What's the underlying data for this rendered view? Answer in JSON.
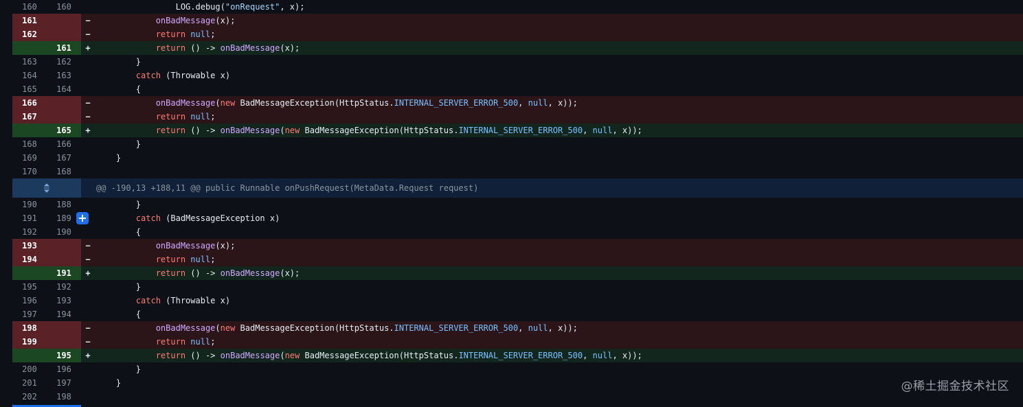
{
  "hunk_header": "@@ -190,13 +188,11 @@ public Runnable onPushRequest(MetaData.Request request)",
  "expand_icon": "expand-icon",
  "add_comment_icon": "plus-icon",
  "watermark": "@稀土掘金技术社区",
  "lines": [
    {
      "type": "ctx",
      "old": "160",
      "new": "160",
      "marker": "",
      "tokens": [
        {
          "c": "tx",
          "t": "                LOG.debug("
        },
        {
          "c": "str",
          "t": "\"onRequest\""
        },
        {
          "c": "tx",
          "t": ", x);"
        }
      ]
    },
    {
      "type": "del",
      "old": "161",
      "new": "",
      "marker": "−",
      "tokens": [
        {
          "c": "tx",
          "t": "            "
        },
        {
          "c": "fn",
          "t": "onBadMessage"
        },
        {
          "c": "tx",
          "t": "(x);"
        }
      ]
    },
    {
      "type": "del",
      "old": "162",
      "new": "",
      "marker": "−",
      "tokens": [
        {
          "c": "tx",
          "t": "            "
        },
        {
          "c": "kw",
          "t": "return"
        },
        {
          "c": "tx",
          "t": " "
        },
        {
          "c": "cn",
          "t": "null"
        },
        {
          "c": "tx",
          "t": ";"
        }
      ]
    },
    {
      "type": "add",
      "old": "",
      "new": "161",
      "marker": "+",
      "tokens": [
        {
          "c": "tx",
          "t": "            "
        },
        {
          "c": "kw",
          "t": "return"
        },
        {
          "c": "tx",
          "t": " () -> "
        },
        {
          "c": "fn",
          "t": "onBadMessage"
        },
        {
          "c": "tx",
          "t": "(x);"
        }
      ]
    },
    {
      "type": "ctx",
      "old": "163",
      "new": "162",
      "marker": "",
      "tokens": [
        {
          "c": "tx",
          "t": "        }"
        }
      ]
    },
    {
      "type": "ctx",
      "old": "164",
      "new": "163",
      "marker": "",
      "tokens": [
        {
          "c": "tx",
          "t": "        "
        },
        {
          "c": "kw",
          "t": "catch"
        },
        {
          "c": "tx",
          "t": " (Throwable x)"
        }
      ]
    },
    {
      "type": "ctx",
      "old": "165",
      "new": "164",
      "marker": "",
      "tokens": [
        {
          "c": "tx",
          "t": "        {"
        }
      ]
    },
    {
      "type": "del",
      "old": "166",
      "new": "",
      "marker": "−",
      "tokens": [
        {
          "c": "tx",
          "t": "            "
        },
        {
          "c": "fn",
          "t": "onBadMessage"
        },
        {
          "c": "tx",
          "t": "("
        },
        {
          "c": "kw",
          "t": "new"
        },
        {
          "c": "tx",
          "t": " BadMessageException(HttpStatus."
        },
        {
          "c": "cn",
          "t": "INTERNAL_SERVER_ERROR_500"
        },
        {
          "c": "tx",
          "t": ", "
        },
        {
          "c": "cn",
          "t": "null"
        },
        {
          "c": "tx",
          "t": ", x));"
        }
      ]
    },
    {
      "type": "del",
      "old": "167",
      "new": "",
      "marker": "−",
      "tokens": [
        {
          "c": "tx",
          "t": "            "
        },
        {
          "c": "kw",
          "t": "return"
        },
        {
          "c": "tx",
          "t": " "
        },
        {
          "c": "cn",
          "t": "null"
        },
        {
          "c": "tx",
          "t": ";"
        }
      ]
    },
    {
      "type": "add",
      "old": "",
      "new": "165",
      "marker": "+",
      "tokens": [
        {
          "c": "tx",
          "t": "            "
        },
        {
          "c": "kw",
          "t": "return"
        },
        {
          "c": "tx",
          "t": " () -> "
        },
        {
          "c": "fn",
          "t": "onBadMessage"
        },
        {
          "c": "tx",
          "t": "("
        },
        {
          "c": "kw",
          "t": "new"
        },
        {
          "c": "tx",
          "t": " BadMessageException(HttpStatus."
        },
        {
          "c": "cn",
          "t": "INTERNAL_SERVER_ERROR_500"
        },
        {
          "c": "tx",
          "t": ", "
        },
        {
          "c": "cn",
          "t": "null"
        },
        {
          "c": "tx",
          "t": ", x));"
        }
      ]
    },
    {
      "type": "ctx",
      "old": "168",
      "new": "166",
      "marker": "",
      "tokens": [
        {
          "c": "tx",
          "t": "        }"
        }
      ]
    },
    {
      "type": "ctx",
      "old": "169",
      "new": "167",
      "marker": "",
      "tokens": [
        {
          "c": "tx",
          "t": "    }"
        }
      ]
    },
    {
      "type": "ctx",
      "old": "170",
      "new": "168",
      "marker": "",
      "tokens": []
    },
    {
      "type": "hunk"
    },
    {
      "type": "ctx",
      "old": "190",
      "new": "188",
      "marker": "",
      "tokens": [
        {
          "c": "tx",
          "t": "        }"
        }
      ]
    },
    {
      "type": "ctx",
      "old": "191",
      "new": "189",
      "marker": "",
      "plus": true,
      "tokens": [
        {
          "c": "tx",
          "t": "        "
        },
        {
          "c": "kw",
          "t": "catch"
        },
        {
          "c": "tx",
          "t": " (BadMessageException x)"
        }
      ]
    },
    {
      "type": "ctx",
      "old": "192",
      "new": "190",
      "marker": "",
      "tokens": [
        {
          "c": "tx",
          "t": "        {"
        }
      ]
    },
    {
      "type": "del",
      "old": "193",
      "new": "",
      "marker": "−",
      "tokens": [
        {
          "c": "tx",
          "t": "            "
        },
        {
          "c": "fn",
          "t": "onBadMessage"
        },
        {
          "c": "tx",
          "t": "(x);"
        }
      ]
    },
    {
      "type": "del",
      "old": "194",
      "new": "",
      "marker": "−",
      "tokens": [
        {
          "c": "tx",
          "t": "            "
        },
        {
          "c": "kw",
          "t": "return"
        },
        {
          "c": "tx",
          "t": " "
        },
        {
          "c": "cn",
          "t": "null"
        },
        {
          "c": "tx",
          "t": ";"
        }
      ]
    },
    {
      "type": "add",
      "old": "",
      "new": "191",
      "marker": "+",
      "tokens": [
        {
          "c": "tx",
          "t": "            "
        },
        {
          "c": "kw",
          "t": "return"
        },
        {
          "c": "tx",
          "t": " () -> "
        },
        {
          "c": "fn",
          "t": "onBadMessage"
        },
        {
          "c": "tx",
          "t": "(x);"
        }
      ]
    },
    {
      "type": "ctx",
      "old": "195",
      "new": "192",
      "marker": "",
      "tokens": [
        {
          "c": "tx",
          "t": "        }"
        }
      ]
    },
    {
      "type": "ctx",
      "old": "196",
      "new": "193",
      "marker": "",
      "tokens": [
        {
          "c": "tx",
          "t": "        "
        },
        {
          "c": "kw",
          "t": "catch"
        },
        {
          "c": "tx",
          "t": " (Throwable x)"
        }
      ]
    },
    {
      "type": "ctx",
      "old": "197",
      "new": "194",
      "marker": "",
      "tokens": [
        {
          "c": "tx",
          "t": "        {"
        }
      ]
    },
    {
      "type": "del",
      "old": "198",
      "new": "",
      "marker": "−",
      "tokens": [
        {
          "c": "tx",
          "t": "            "
        },
        {
          "c": "fn",
          "t": "onBadMessage"
        },
        {
          "c": "tx",
          "t": "("
        },
        {
          "c": "kw",
          "t": "new"
        },
        {
          "c": "tx",
          "t": " BadMessageException(HttpStatus."
        },
        {
          "c": "cn",
          "t": "INTERNAL_SERVER_ERROR_500"
        },
        {
          "c": "tx",
          "t": ", "
        },
        {
          "c": "cn",
          "t": "null"
        },
        {
          "c": "tx",
          "t": ", x));"
        }
      ]
    },
    {
      "type": "del",
      "old": "199",
      "new": "",
      "marker": "−",
      "tokens": [
        {
          "c": "tx",
          "t": "            "
        },
        {
          "c": "kw",
          "t": "return"
        },
        {
          "c": "tx",
          "t": " "
        },
        {
          "c": "cn",
          "t": "null"
        },
        {
          "c": "tx",
          "t": ";"
        }
      ]
    },
    {
      "type": "add",
      "old": "",
      "new": "195",
      "marker": "+",
      "tokens": [
        {
          "c": "tx",
          "t": "            "
        },
        {
          "c": "kw",
          "t": "return"
        },
        {
          "c": "tx",
          "t": " () -> "
        },
        {
          "c": "fn",
          "t": "onBadMessage"
        },
        {
          "c": "tx",
          "t": "("
        },
        {
          "c": "kw",
          "t": "new"
        },
        {
          "c": "tx",
          "t": " BadMessageException(HttpStatus."
        },
        {
          "c": "cn",
          "t": "INTERNAL_SERVER_ERROR_500"
        },
        {
          "c": "tx",
          "t": ", "
        },
        {
          "c": "cn",
          "t": "null"
        },
        {
          "c": "tx",
          "t": ", x));"
        }
      ]
    },
    {
      "type": "ctx",
      "old": "200",
      "new": "196",
      "marker": "",
      "tokens": [
        {
          "c": "tx",
          "t": "        }"
        }
      ]
    },
    {
      "type": "ctx",
      "old": "201",
      "new": "197",
      "marker": "",
      "tokens": [
        {
          "c": "tx",
          "t": "    }"
        }
      ]
    },
    {
      "type": "ctx",
      "old": "202",
      "new": "198",
      "marker": "",
      "tokens": []
    }
  ]
}
